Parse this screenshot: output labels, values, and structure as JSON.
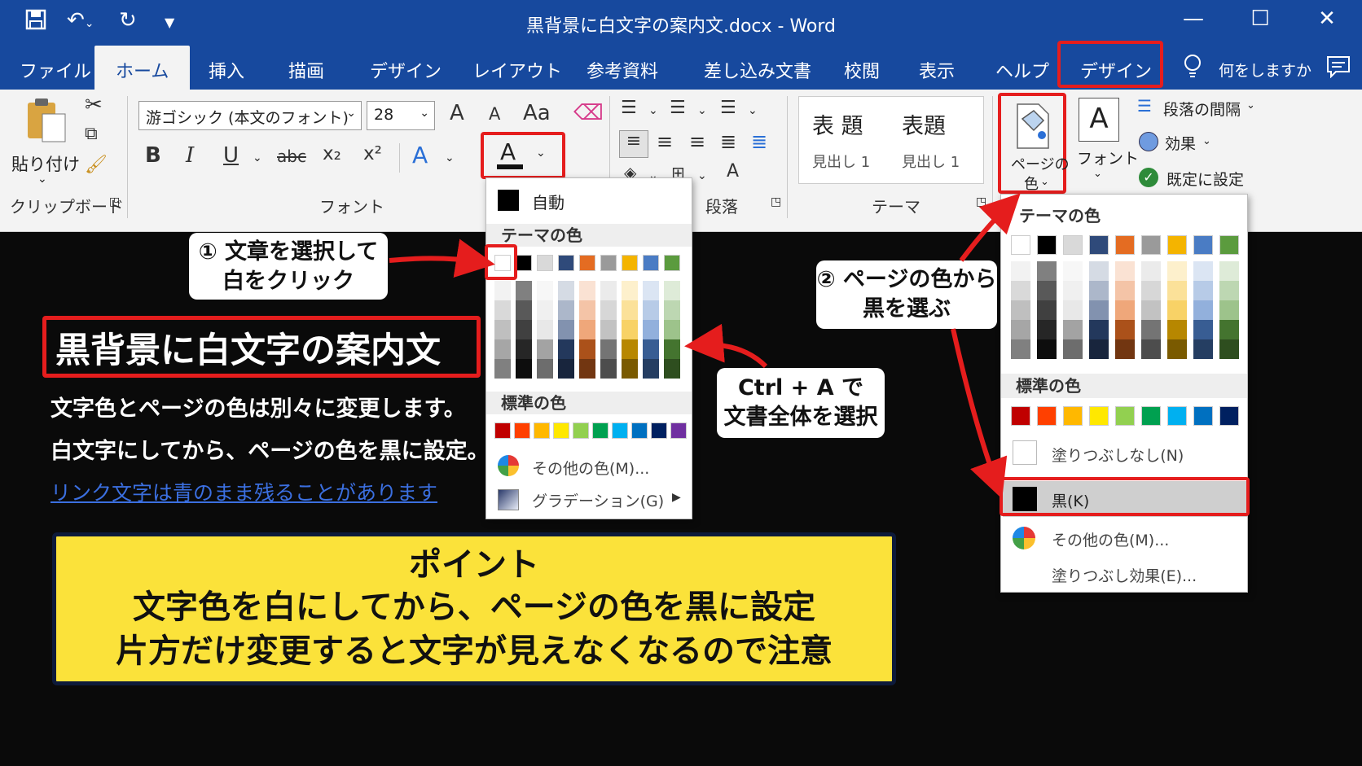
{
  "window": {
    "title": "黒背景に白文字の案内文.docx  -  Word",
    "minimize": "—",
    "maximize": "☐",
    "close": "✕"
  },
  "tabs": {
    "file": "ファイル",
    "home": "ホーム",
    "insert": "挿入",
    "draw": "描画",
    "design": "デザイン",
    "layout": "レイアウト",
    "references": "参考資料",
    "mailings": "差し込み文書",
    "review": "校閲",
    "view": "表示",
    "help": "ヘルプ",
    "design2": "デザイン",
    "tell_me": "何をしますか"
  },
  "clipboard": {
    "paste": "貼り付け",
    "group": "クリップボード"
  },
  "font": {
    "name": "游ゴシック (本文のフォント)",
    "size": "28",
    "group": "フォント",
    "bold": "B",
    "italic": "I",
    "underline": "U",
    "strike": "abc",
    "subscript": "x₂",
    "superscript": "x²",
    "grow": "A",
    "shrink": "A",
    "case": "Aa",
    "color_letter": "A"
  },
  "paragraph": {
    "group": "段落"
  },
  "styles": {
    "group": "テーマ",
    "items": [
      {
        "title": "表 題",
        "sub": "見出し 1"
      },
      {
        "title": "表題",
        "sub": "見出し 1"
      }
    ]
  },
  "page_bg": {
    "page_color_line1": "ページの",
    "page_color_line2": "色",
    "fonts": "フォント",
    "fonts_letter": "A",
    "spacing": "段落の間隔",
    "effects": "効果",
    "set_default": "既定に設定"
  },
  "font_color_menu": {
    "auto": "自動",
    "theme_title": "テーマの色",
    "standard_title": "標準の色",
    "more": "その他の色(M)...",
    "gradient": "グラデーション(G)"
  },
  "page_color_menu": {
    "theme_title": "テーマの色",
    "standard_title": "標準の色",
    "no_fill": "塗りつぶしなし(N)",
    "black": "黒(K)",
    "more": "その他の色(M)...",
    "fill_effects": "塗りつぶし効果(E)..."
  },
  "colors": {
    "theme_top": [
      "#ffffff",
      "#000000",
      "#d9d9d9",
      "#2f4a7a",
      "#e46c22",
      "#9a9a9a",
      "#f4b400",
      "#4a7cc4",
      "#5b9b3e"
    ],
    "standard": [
      "#c00000",
      "#ff4000",
      "#ffb800",
      "#ffe800",
      "#92d050",
      "#00a050",
      "#00b0f0",
      "#0070c0",
      "#002060",
      "#7030a0"
    ],
    "accent": "#17499e",
    "callout_red": "#e51d1d",
    "point_bg": "#fbe23a"
  },
  "callouts": {
    "step1_line1": "① 文章を選択して",
    "step1_line2": "白をクリック",
    "step2_line1": "② ページの色から",
    "step2_line2": "黒を選ぶ",
    "ctrl_line1": "Ctrl + A で",
    "ctrl_line2": "文書全体を選択"
  },
  "document": {
    "heading": "黒背景に白文字の案内文",
    "line1": "文字色とページの色は別々に変更します。",
    "line2": "白文字にしてから、ページの色を黒に設定。",
    "link": "リンク文字は青のまま残ることがあります"
  },
  "point": {
    "title": "ポイント",
    "line1": "文字色を白にしてから、ページの色を黒に設定",
    "line2": "片方だけ変更すると文字が見えなくなるので注意"
  }
}
